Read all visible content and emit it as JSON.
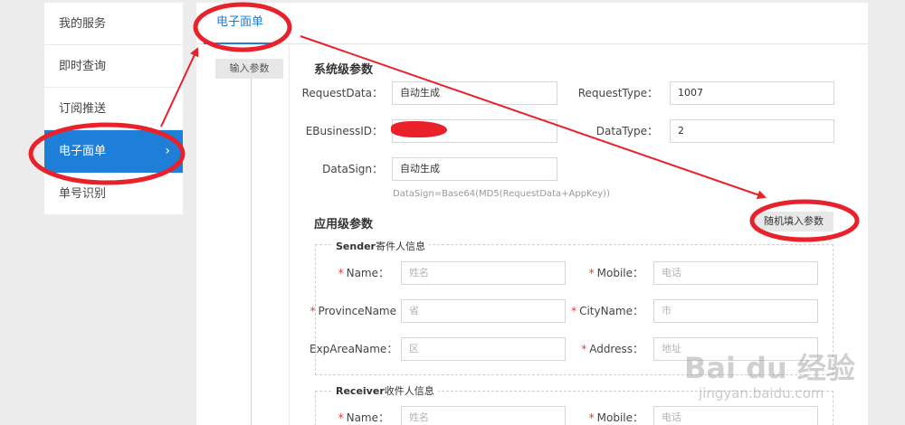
{
  "sidebar": {
    "items": [
      {
        "label": "我的服务"
      },
      {
        "label": "即时查询"
      },
      {
        "label": "订阅推送"
      },
      {
        "label": "电子面单",
        "active": true
      },
      {
        "label": "单号识别"
      }
    ],
    "chevron": "›"
  },
  "tabs": [
    {
      "label": "电子面单"
    }
  ],
  "input_params_tag": "输入参数",
  "system_params": {
    "title": "系统级参数",
    "request_data": {
      "label": "RequestData：",
      "value": "自动生成"
    },
    "request_type": {
      "label": "RequestType：",
      "value": "1007"
    },
    "ebusiness_id": {
      "label": "EBusinessID：",
      "value": ""
    },
    "data_type": {
      "label": "DataType：",
      "value": "2"
    },
    "data_sign": {
      "label": "DataSign：",
      "value": "自动生成"
    },
    "data_sign_hint": "DataSign=Base64(MD5(RequestData+AppKey))"
  },
  "app_params": {
    "title": "应用级参数",
    "random_fill_button": "随机填入参数"
  },
  "sender": {
    "legend_en": "Sender",
    "legend_cn": "寄件人信息",
    "name": {
      "label": "Name：",
      "placeholder": "姓名"
    },
    "mobile": {
      "label": "Mobile：",
      "placeholder": "电话"
    },
    "province": {
      "label": "ProvinceName",
      "placeholder": "省"
    },
    "city": {
      "label": "CityName：",
      "placeholder": "市"
    },
    "exparea": {
      "label": "ExpAreaName：",
      "placeholder": "区"
    },
    "address": {
      "label": "Address：",
      "placeholder": "地址"
    }
  },
  "receiver": {
    "legend_en": "Receiver",
    "legend_cn": "收件人信息",
    "name": {
      "label": "Name：",
      "placeholder": "姓名"
    },
    "mobile": {
      "label": "Mobile：",
      "placeholder": "电话"
    }
  },
  "required_mark": "*",
  "watermark": {
    "main": "Bai du 经验",
    "sub": "jingyan.baidu.com"
  },
  "colors": {
    "accent": "#1e7fd8",
    "annotation": "#e8212b",
    "required": "#e53935"
  }
}
